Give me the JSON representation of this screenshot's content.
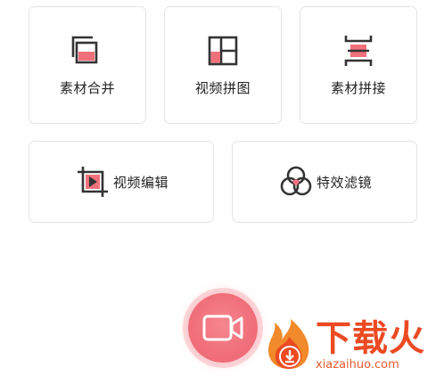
{
  "tools": {
    "material_merge": {
      "label": "素材合并",
      "icon": "material-merge-icon"
    },
    "video_collage": {
      "label": "视频拼图",
      "icon": "video-collage-icon"
    },
    "material_splice": {
      "label": "素材拼接",
      "icon": "material-splice-icon"
    },
    "video_edit": {
      "label": "视频编辑",
      "icon": "video-edit-icon"
    },
    "effects_filter": {
      "label": "特效滤镜",
      "icon": "effects-filter-icon"
    }
  },
  "record_button": {
    "icon": "video-camera-icon"
  },
  "watermark": {
    "title": "下载火",
    "domain": "xiazaihuo.com",
    "logo": "flame-download-logo"
  },
  "colors": {
    "accent": "#f0707b",
    "accent_light": "#f7a5ad",
    "icon_dark": "#333333",
    "card_border": "#e4e4e4",
    "watermark_orange": "#ec4a22"
  }
}
